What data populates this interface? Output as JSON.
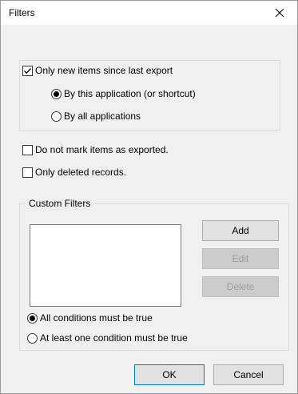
{
  "window": {
    "title": "Filters"
  },
  "only_new": {
    "label": "Only new items since last export",
    "checked": true,
    "options": [
      {
        "label": "By this application (or shortcut)",
        "selected": true
      },
      {
        "label": "By all applications",
        "selected": false
      }
    ]
  },
  "do_not_mark": {
    "label": "Do not mark items as exported.",
    "checked": false
  },
  "only_deleted": {
    "label": "Only deleted records.",
    "checked": false
  },
  "custom_filters": {
    "caption": "Custom Filters",
    "items": [],
    "buttons": {
      "add": "Add",
      "edit": "Edit",
      "delete": "Delete"
    },
    "conditions": [
      {
        "label": "All conditions must be true",
        "selected": true
      },
      {
        "label": "At least one condition must be true",
        "selected": false
      }
    ]
  },
  "footer": {
    "ok": "OK",
    "cancel": "Cancel"
  },
  "colors": {
    "focus_border": "#0078d7",
    "disabled_text": "#9c9c9c"
  }
}
